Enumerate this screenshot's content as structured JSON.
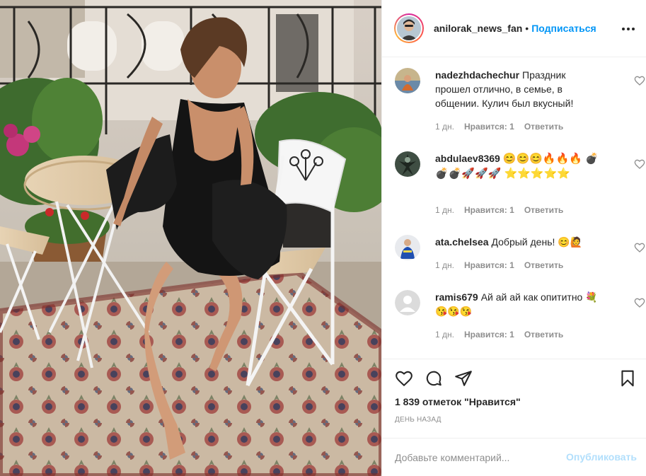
{
  "header": {
    "username": "anilorak_news_fan",
    "separator": "•",
    "follow_label": "Подписаться",
    "more_icon": "ellipsis-icon"
  },
  "comments": [
    {
      "username": "nadezhdachechur",
      "text": "Праздник прошел отлично, в семье, в общении. Кулич был вкусный!",
      "time": "1 дн.",
      "likes": "Нравится: 1",
      "reply": "Ответить"
    },
    {
      "username": "abdulaev8369",
      "text": "😊😊😊🔥🔥🔥 💣💣💣🚀🚀🚀 ⭐⭐⭐⭐⭐",
      "time": "1 дн.",
      "likes": "Нравится: 1",
      "reply": "Ответить"
    },
    {
      "username": "ata.chelsea",
      "text": "Добрый день! 😊🙋",
      "time": "1 дн.",
      "likes": "Нравится: 1",
      "reply": "Ответить"
    },
    {
      "username": "ramis679",
      "text": "Ай ай ай как опититно 💐😘😘😘",
      "time": "1 дн.",
      "likes": "Нравится: 1",
      "reply": "Ответить"
    }
  ],
  "actions": {
    "like_icon": "heart-icon",
    "comment_icon": "comment-icon",
    "share_icon": "paper-plane-icon",
    "save_icon": "bookmark-icon"
  },
  "likes_text": "1 839 отметок \"Нравится\"",
  "date_text": "ДЕНЬ НАЗАД",
  "add_comment": {
    "placeholder": "Добавьте комментарий...",
    "post_label": "Опубликовать"
  },
  "colors": {
    "accent": "#0095f6",
    "post_disabled": "#b2dffc",
    "muted": "#8e8e8e",
    "text": "#262626",
    "border": "#efefef"
  }
}
